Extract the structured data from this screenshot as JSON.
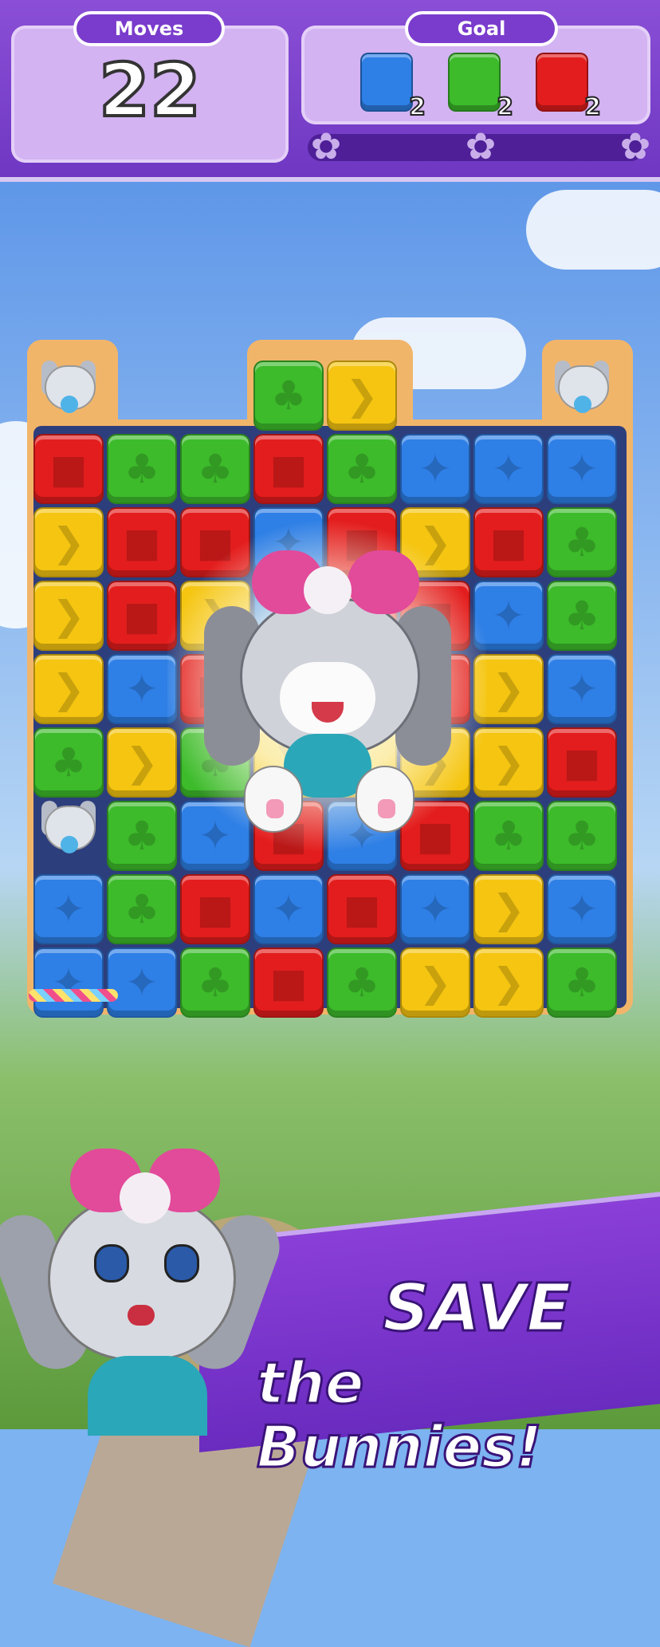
{
  "header": {
    "moves_label": "Moves",
    "moves_value": "22",
    "goal_label": "Goal",
    "goals": [
      {
        "color": "blue",
        "count": "2"
      },
      {
        "color": "green",
        "count": "2"
      },
      {
        "color": "red",
        "count": "2"
      }
    ],
    "progress_stars": [
      "star-icon",
      "star-icon",
      "star-icon"
    ],
    "progress_fraction": 0
  },
  "board": {
    "rows": [
      [
        "bunny",
        "empty",
        "empty",
        "green",
        "yellow",
        "empty",
        "empty",
        "bunny"
      ],
      [
        "red",
        "green",
        "green",
        "red",
        "green",
        "blue",
        "blue",
        "blue"
      ],
      [
        "yellow",
        "red",
        "red",
        "blue",
        "red",
        "yellow",
        "red",
        "green"
      ],
      [
        "yellow",
        "red",
        "yellow",
        "blue",
        "red",
        "red",
        "blue",
        "green"
      ],
      [
        "yellow",
        "blue",
        "red",
        "red",
        "red",
        "red",
        "yellow",
        "blue"
      ],
      [
        "green",
        "yellow",
        "green",
        "yellow",
        "yellow",
        "yellow",
        "yellow",
        "red"
      ],
      [
        "bunny",
        "green",
        "blue",
        "red",
        "blue",
        "red",
        "green",
        "green"
      ],
      [
        "blue",
        "green",
        "red",
        "blue",
        "red",
        "blue",
        "yellow",
        "blue"
      ],
      [
        "blue",
        "blue",
        "green",
        "red",
        "green",
        "yellow",
        "yellow",
        "green"
      ]
    ],
    "tile_icons": {
      "red": "■",
      "blue": "✦",
      "green": "♣",
      "yellow": "❯"
    }
  },
  "banner": {
    "line1": "SAVE",
    "line2": "the Bunnies!"
  },
  "colors": {
    "red": "#e31d1d",
    "blue": "#2e7fe6",
    "green": "#3dbb2b",
    "yellow": "#f5c511",
    "header_purple": "#7a3ccc"
  }
}
